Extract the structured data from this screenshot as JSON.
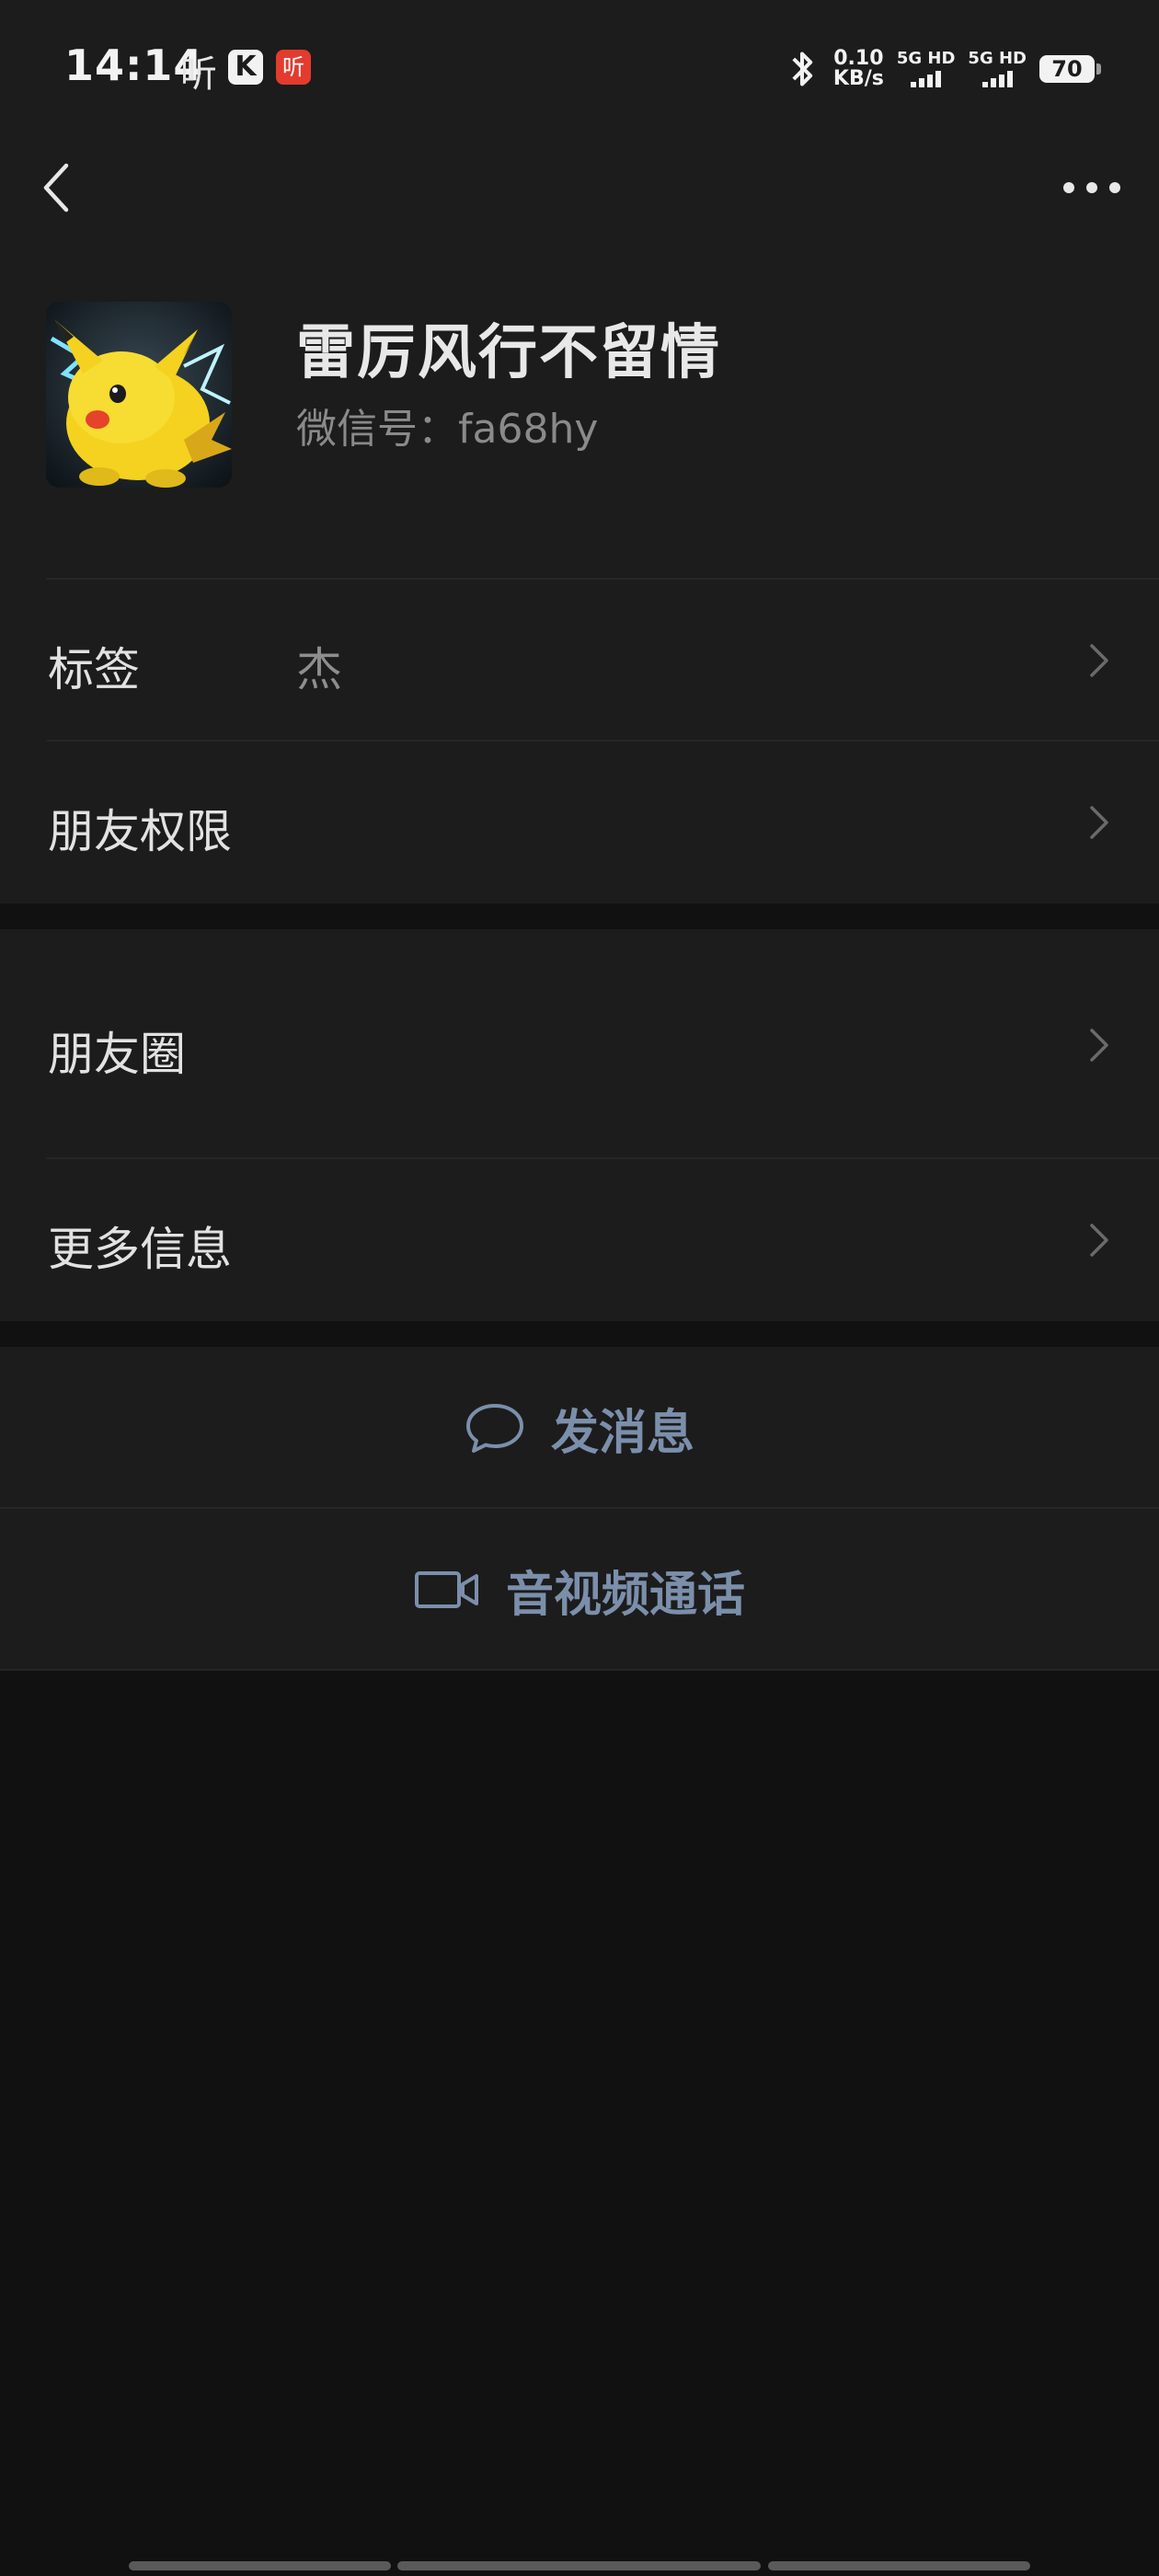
{
  "status_bar": {
    "time": "14:14",
    "listen_icon_text": "听",
    "k_icon_text": "K",
    "red_icon_text": "听",
    "net_speed_value": "0.10",
    "net_speed_unit": "KB/s",
    "sim1_label": "5G HD",
    "sim2_label": "5G HD",
    "battery_level": "70"
  },
  "nav": {
    "back_icon": "back-arrow-icon",
    "more_icon": "ellipsis-icon"
  },
  "profile": {
    "nickname": "雷厉风行不留情",
    "wechat_id": "微信号：fa68hy",
    "avatar_desc": "pikachu"
  },
  "rows": {
    "tags_label": "标签",
    "tags_value": "杰",
    "permissions_label": "朋友权限",
    "moments_label": "朋友圈",
    "more_info_label": "更多信息"
  },
  "actions": {
    "message_label": "发消息",
    "call_label": "音视频通话"
  },
  "colors": {
    "background": "#111111",
    "surface": "#1c1c1c",
    "action_text": "#7b8fab"
  }
}
